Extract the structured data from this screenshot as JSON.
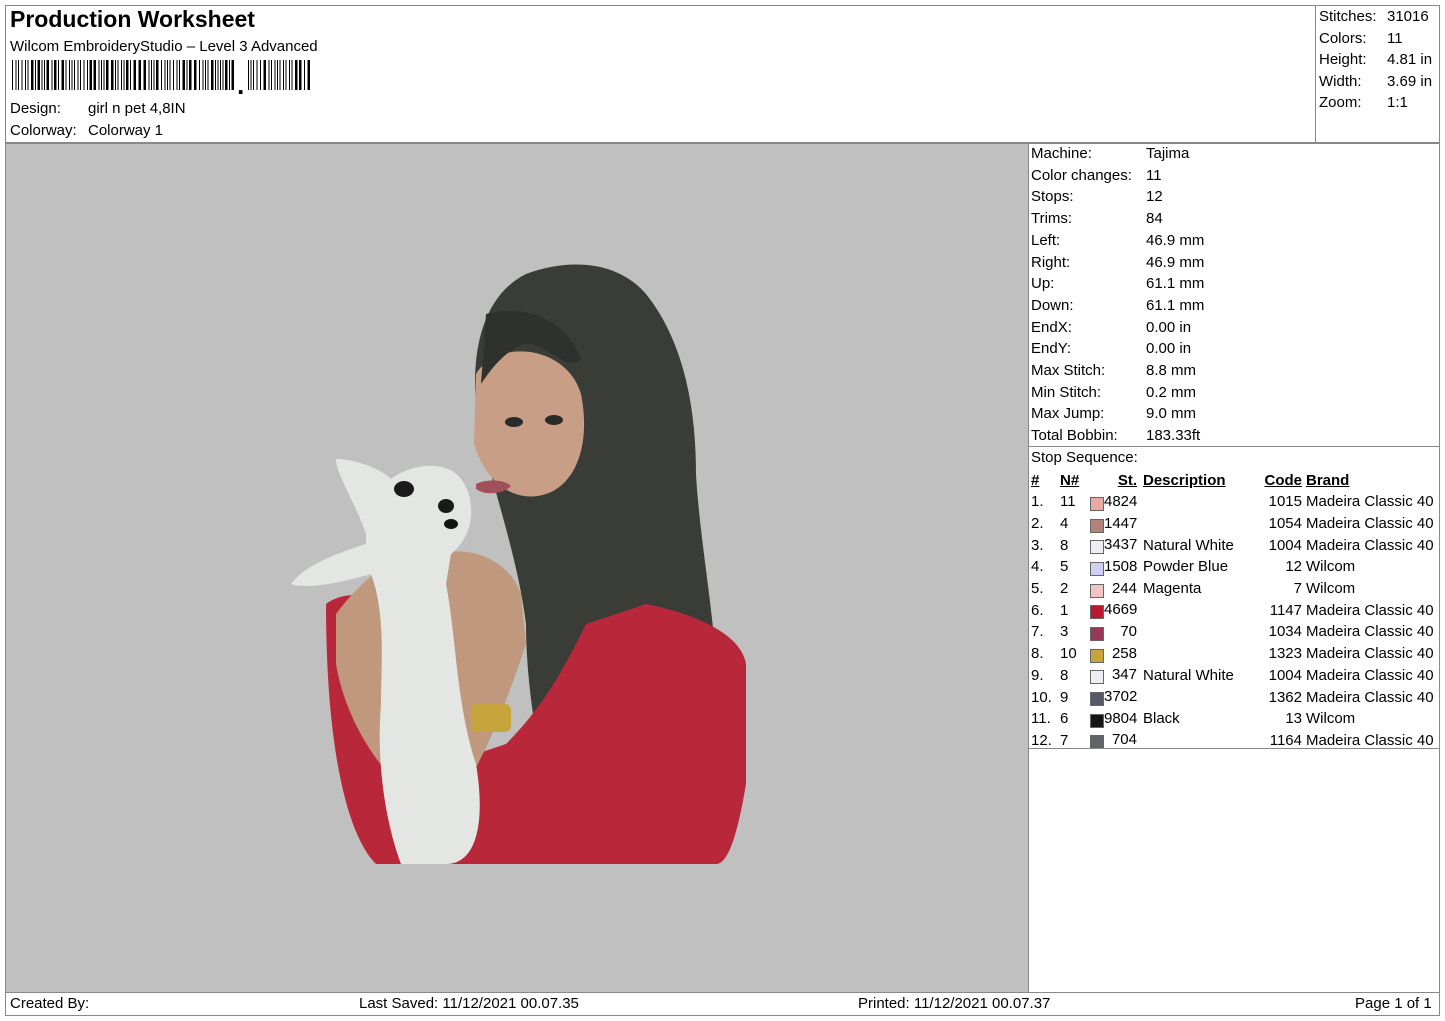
{
  "header": {
    "title": "Production Worksheet",
    "software": "Wilcom EmbroideryStudio – Level 3 Advanced",
    "barcode_icon": "barcode-icon",
    "design_label": "Design:",
    "design_value": "girl n pet 4,8IN",
    "colorway_label": "Colorway:",
    "colorway_value": "Colorway 1"
  },
  "summary": [
    {
      "label": "Stitches:",
      "value": "31016"
    },
    {
      "label": "Colors:",
      "value": "11"
    },
    {
      "label": "Height:",
      "value": "4.81 in"
    },
    {
      "label": "Width:",
      "value": "3.69 in"
    },
    {
      "label": "Zoom:",
      "value": "1:1"
    }
  ],
  "machine_info": [
    {
      "label": "Machine:",
      "value": "Tajima"
    },
    {
      "label": "Color changes:",
      "value": "11"
    },
    {
      "label": "Stops:",
      "value": "12"
    },
    {
      "label": "Trims:",
      "value": "84"
    },
    {
      "label": "Left:",
      "value": "46.9 mm"
    },
    {
      "label": "Right:",
      "value": "46.9 mm"
    },
    {
      "label": "Up:",
      "value": "61.1 mm"
    },
    {
      "label": "Down:",
      "value": "61.1 mm"
    },
    {
      "label": "EndX:",
      "value": "0.00 in"
    },
    {
      "label": "EndY:",
      "value": "0.00 in"
    },
    {
      "label": "Max Stitch:",
      "value": "8.8 mm"
    },
    {
      "label": "Min Stitch:",
      "value": "0.2 mm"
    },
    {
      "label": "Max Jump:",
      "value": "9.0 mm"
    },
    {
      "label": "Total Bobbin:",
      "value": "183.33ft"
    }
  ],
  "stop_sequence": {
    "title": "Stop Sequence:",
    "headers": {
      "num": "#",
      "needle": "N#",
      "stitches": "St.",
      "description": "Description",
      "code": "Code",
      "brand": "Brand"
    },
    "rows": [
      {
        "num": "1.",
        "needle": "11",
        "color": "#e8a8a4",
        "stitches": "4824",
        "description": "",
        "code": "1015",
        "brand": "Madeira Classic 40"
      },
      {
        "num": "2.",
        "needle": "4",
        "color": "#b08478",
        "stitches": "1447",
        "description": "",
        "code": "1054",
        "brand": "Madeira Classic 40"
      },
      {
        "num": "3.",
        "needle": "8",
        "color": "#eeeef2",
        "stitches": "3437",
        "description": "Natural White",
        "code": "1004",
        "brand": "Madeira Classic 40"
      },
      {
        "num": "4.",
        "needle": "5",
        "color": "#cfd0f4",
        "stitches": "1508",
        "description": "Powder Blue",
        "code": "12",
        "brand": "Wilcom"
      },
      {
        "num": "5.",
        "needle": "2",
        "color": "#f2c4c4",
        "stitches": "244",
        "description": "Magenta",
        "code": "7",
        "brand": "Wilcom"
      },
      {
        "num": "6.",
        "needle": "1",
        "color": "#b81830",
        "stitches": "4669",
        "description": "",
        "code": "1147",
        "brand": "Madeira Classic 40"
      },
      {
        "num": "7.",
        "needle": "3",
        "color": "#983858",
        "stitches": "70",
        "description": "",
        "code": "1034",
        "brand": "Madeira Classic 40"
      },
      {
        "num": "8.",
        "needle": "10",
        "color": "#c8a43c",
        "stitches": "258",
        "description": "",
        "code": "1323",
        "brand": "Madeira Classic 40"
      },
      {
        "num": "9.",
        "needle": "8",
        "color": "#eeeef2",
        "stitches": "347",
        "description": "Natural White",
        "code": "1004",
        "brand": "Madeira Classic 40"
      },
      {
        "num": "10.",
        "needle": "9",
        "color": "#585868",
        "stitches": "3702",
        "description": "",
        "code": "1362",
        "brand": "Madeira Classic 40"
      },
      {
        "num": "11.",
        "needle": "6",
        "color": "#141414",
        "stitches": "9804",
        "description": "Black",
        "code": "13",
        "brand": "Wilcom"
      },
      {
        "num": "12.",
        "needle": "7",
        "color": "#606468",
        "stitches": "704",
        "description": "",
        "code": "1164",
        "brand": "Madeira Classic 40"
      }
    ]
  },
  "footer": {
    "created_by": "Created By:",
    "last_saved": "Last Saved: 11/12/2021 00.07.35",
    "printed": "Printed: 11/12/2021 00.07.37",
    "page": "Page 1 of 1"
  },
  "colors": {
    "canvas_bg": "#c0c0c0",
    "border": "#888888"
  },
  "design_preview": {
    "description_icon": "embroidery-design-preview"
  }
}
